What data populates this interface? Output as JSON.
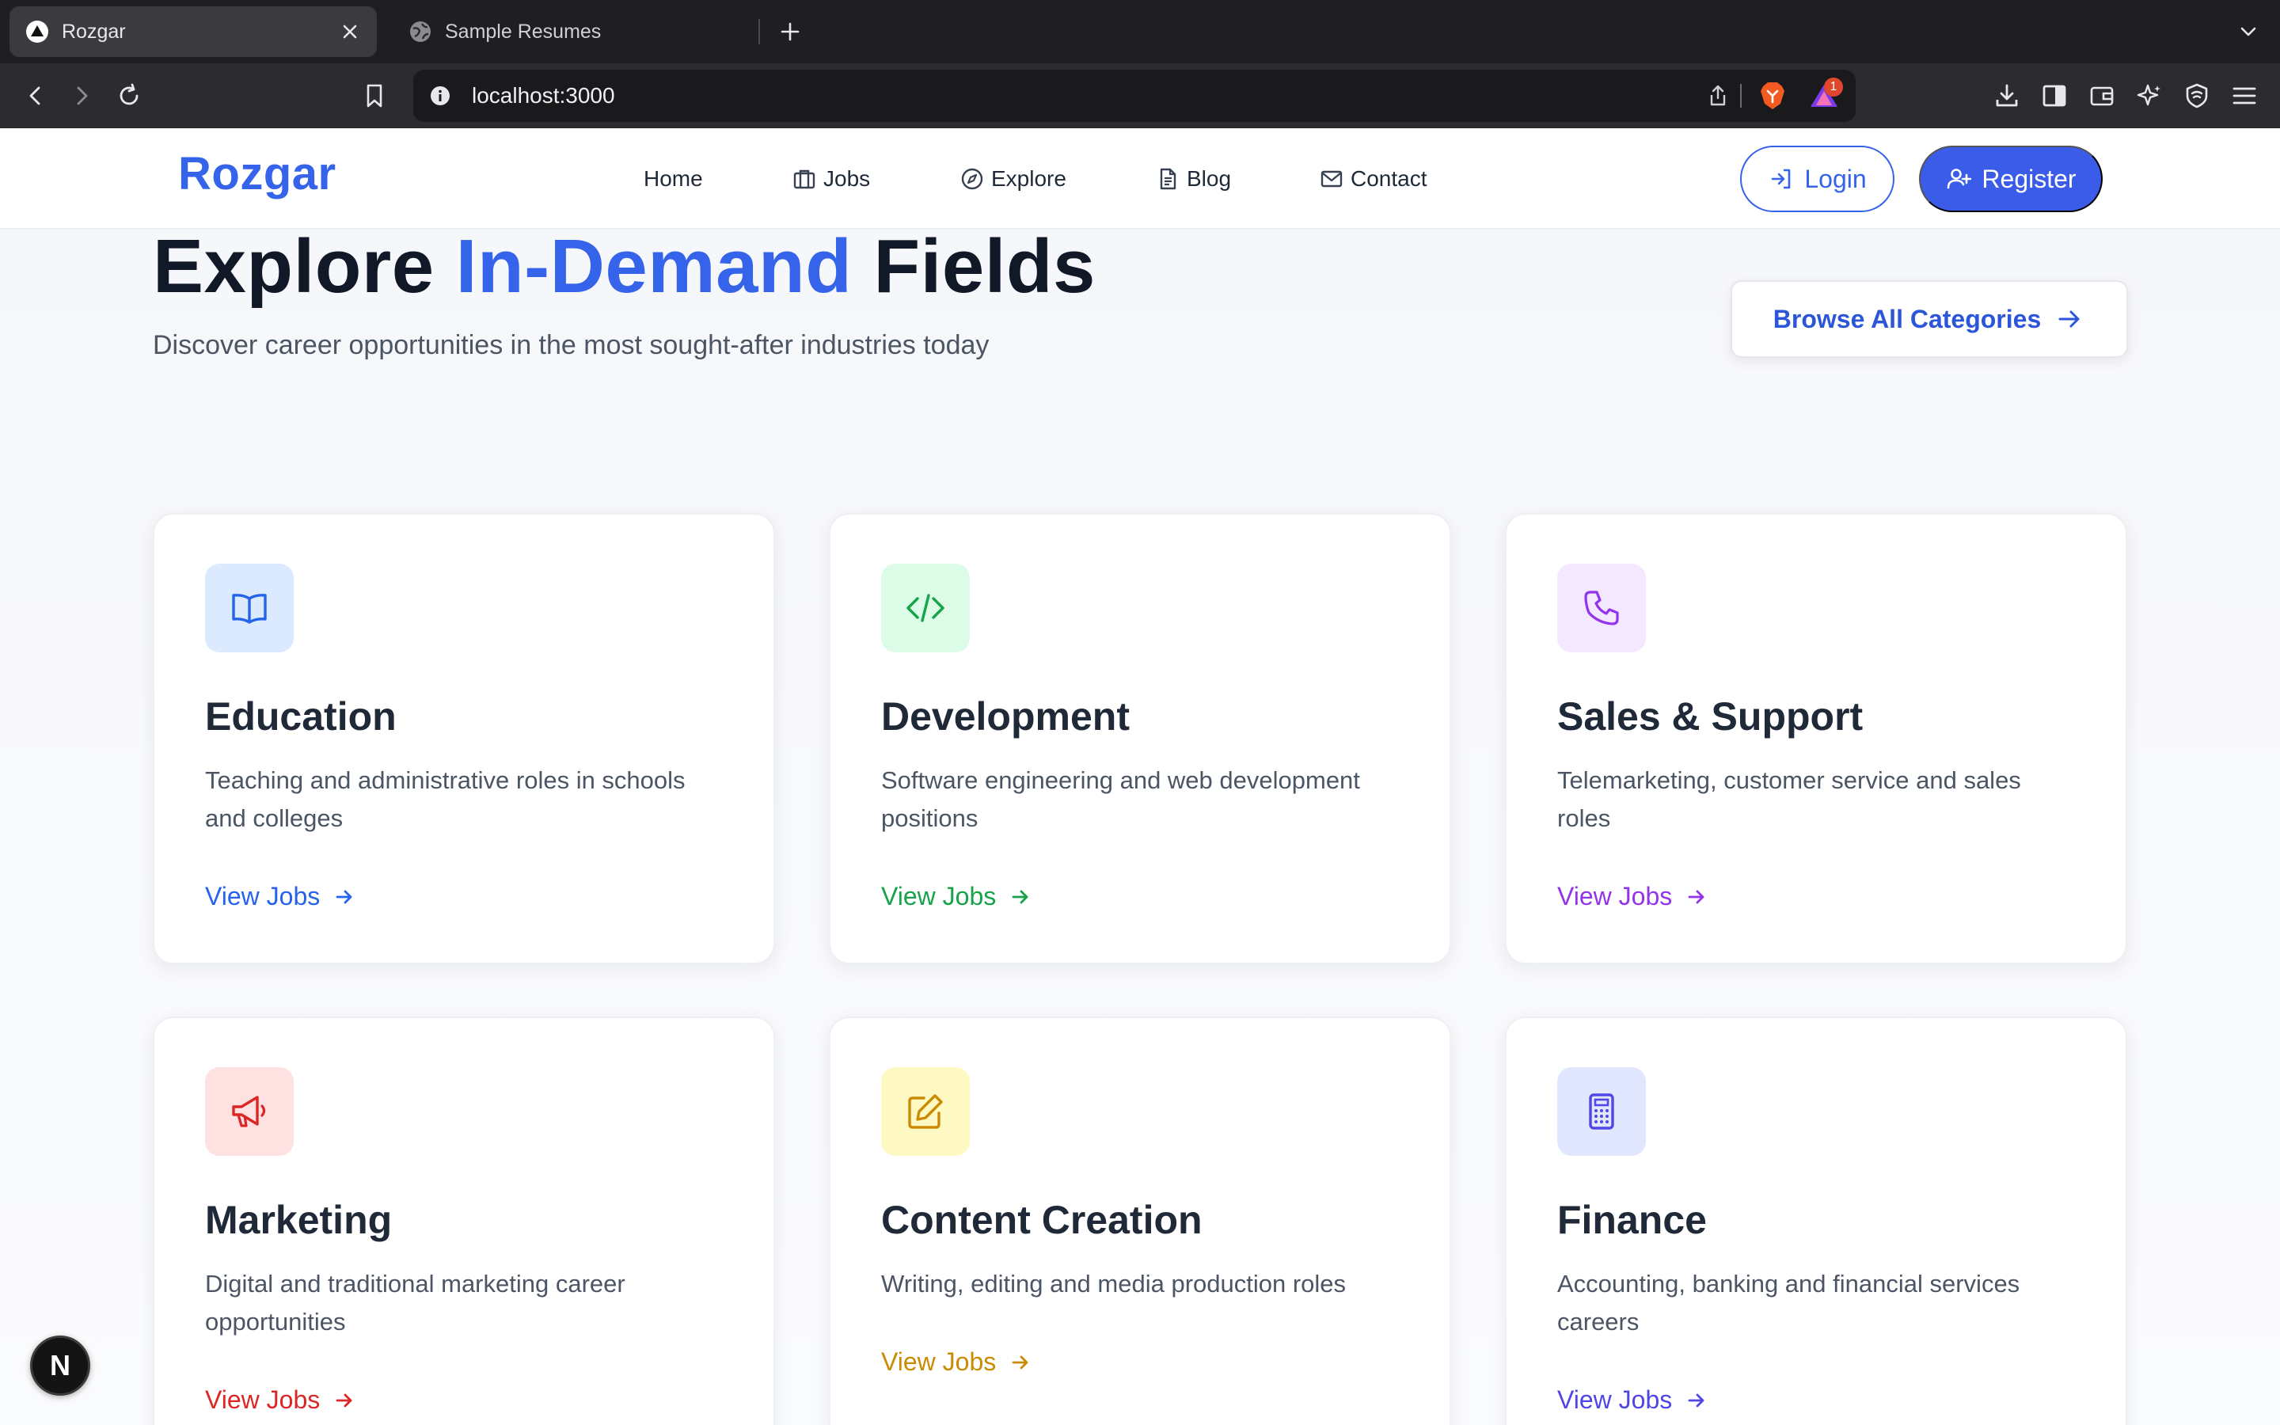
{
  "browser": {
    "tabs": [
      {
        "title": "Rozgar",
        "icon": "triangle-favicon-icon",
        "active": true
      },
      {
        "title": "Sample Resumes",
        "icon": "globe-icon",
        "active": false
      }
    ],
    "url": "localhost:3000",
    "rewards_badge": "1"
  },
  "header": {
    "logo": "Rozgar",
    "nav": [
      {
        "label": "Home",
        "icon": ""
      },
      {
        "label": "Jobs",
        "icon": "briefcase-icon"
      },
      {
        "label": "Explore",
        "icon": "compass-icon"
      },
      {
        "label": "Blog",
        "icon": "document-icon"
      },
      {
        "label": "Contact",
        "icon": "mail-icon"
      }
    ],
    "login_label": "Login",
    "register_label": "Register"
  },
  "hero": {
    "heading_part1": "Explore ",
    "heading_accent": "In-Demand",
    "heading_part2": " Fields",
    "subheading": "Discover career opportunities in the most sought-after industries today",
    "browse_label": "Browse All Categories"
  },
  "categories": [
    {
      "title": "Education",
      "description": "Teaching and administrative roles in schools and colleges",
      "link": "View Jobs",
      "icon": "book-icon",
      "color": "#2563eb",
      "bg": "#dbeafe"
    },
    {
      "title": "Development",
      "description": "Software engineering and web development positions",
      "link": "View Jobs",
      "icon": "code-icon",
      "color": "#16a34a",
      "bg": "#dcfce7"
    },
    {
      "title": "Sales & Support",
      "description": "Telemarketing, customer service and sales roles",
      "link": "View Jobs",
      "icon": "phone-icon",
      "color": "#9333ea",
      "bg": "#f3e8ff"
    },
    {
      "title": "Marketing",
      "description": "Digital and traditional marketing career opportunities",
      "link": "View Jobs",
      "icon": "megaphone-icon",
      "color": "#dc2626",
      "bg": "#fee2e2"
    },
    {
      "title": "Content Creation",
      "description": "Writing, editing and media production roles",
      "link": "View Jobs",
      "icon": "edit-icon",
      "color": "#ca8a04",
      "bg": "#fef9c3"
    },
    {
      "title": "Finance",
      "description": "Accounting, banking and financial services careers",
      "link": "View Jobs",
      "icon": "calculator-icon",
      "color": "#4f46e5",
      "bg": "#e0e7ff"
    }
  ],
  "dev_badge": "N"
}
